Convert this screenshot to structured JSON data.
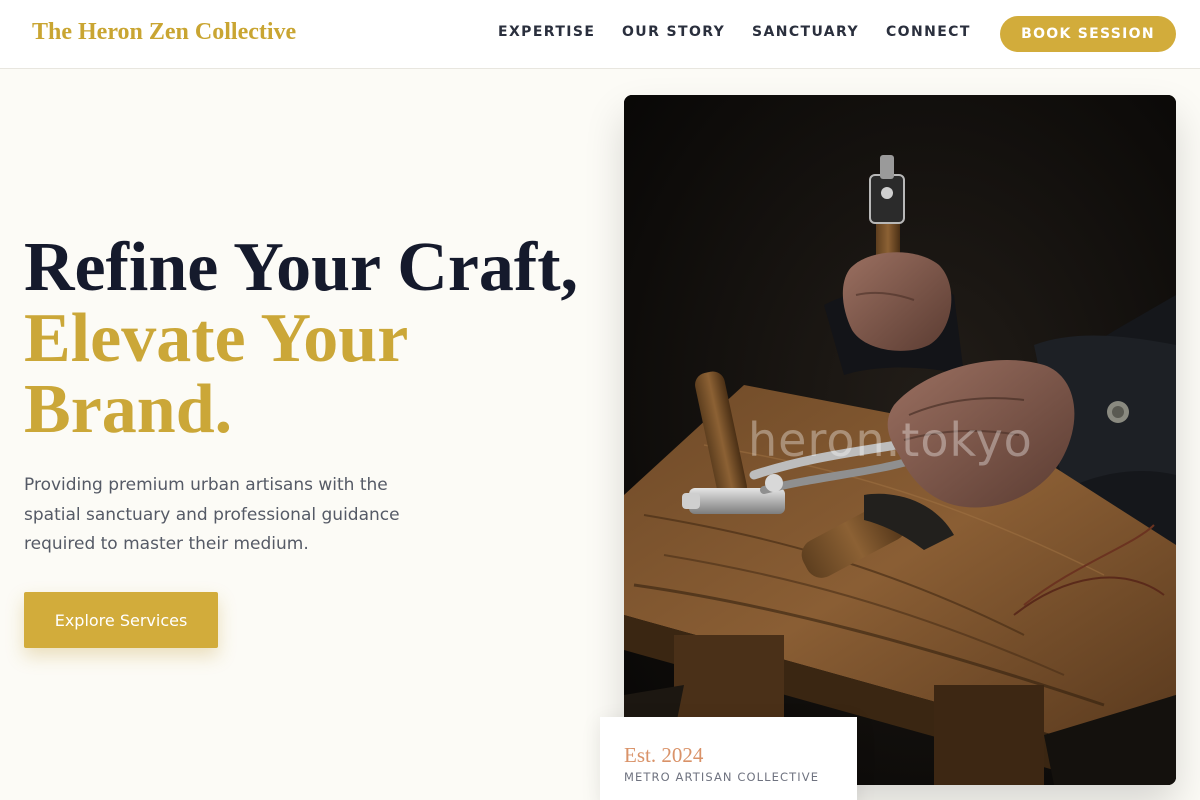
{
  "header": {
    "logo": "The Heron Zen Collective",
    "nav": [
      {
        "label": "EXPERTISE"
      },
      {
        "label": "OUR STORY"
      },
      {
        "label": "SANCTUARY"
      },
      {
        "label": "CONNECT"
      }
    ],
    "cta_label": "BOOK SESSION"
  },
  "hero": {
    "headline_line1": "Refine Your Craft,",
    "headline_accent_line1": "Elevate Your",
    "headline_accent_line2": "Brand.",
    "subtext": "Providing premium urban artisans with the spatial sanctuary and professional guidance required to master their medium.",
    "cta_label": "Explore Services"
  },
  "image": {
    "watermark": "heron.tokyo"
  },
  "est_card": {
    "year": "Est. 2024",
    "subtitle": "METRO ARTISAN COLLECTIVE"
  },
  "colors": {
    "accent_gold": "#d2ac3b",
    "heading_dark": "#151a2c",
    "page_bg": "#fcfbf6",
    "est_year": "#d99268"
  }
}
